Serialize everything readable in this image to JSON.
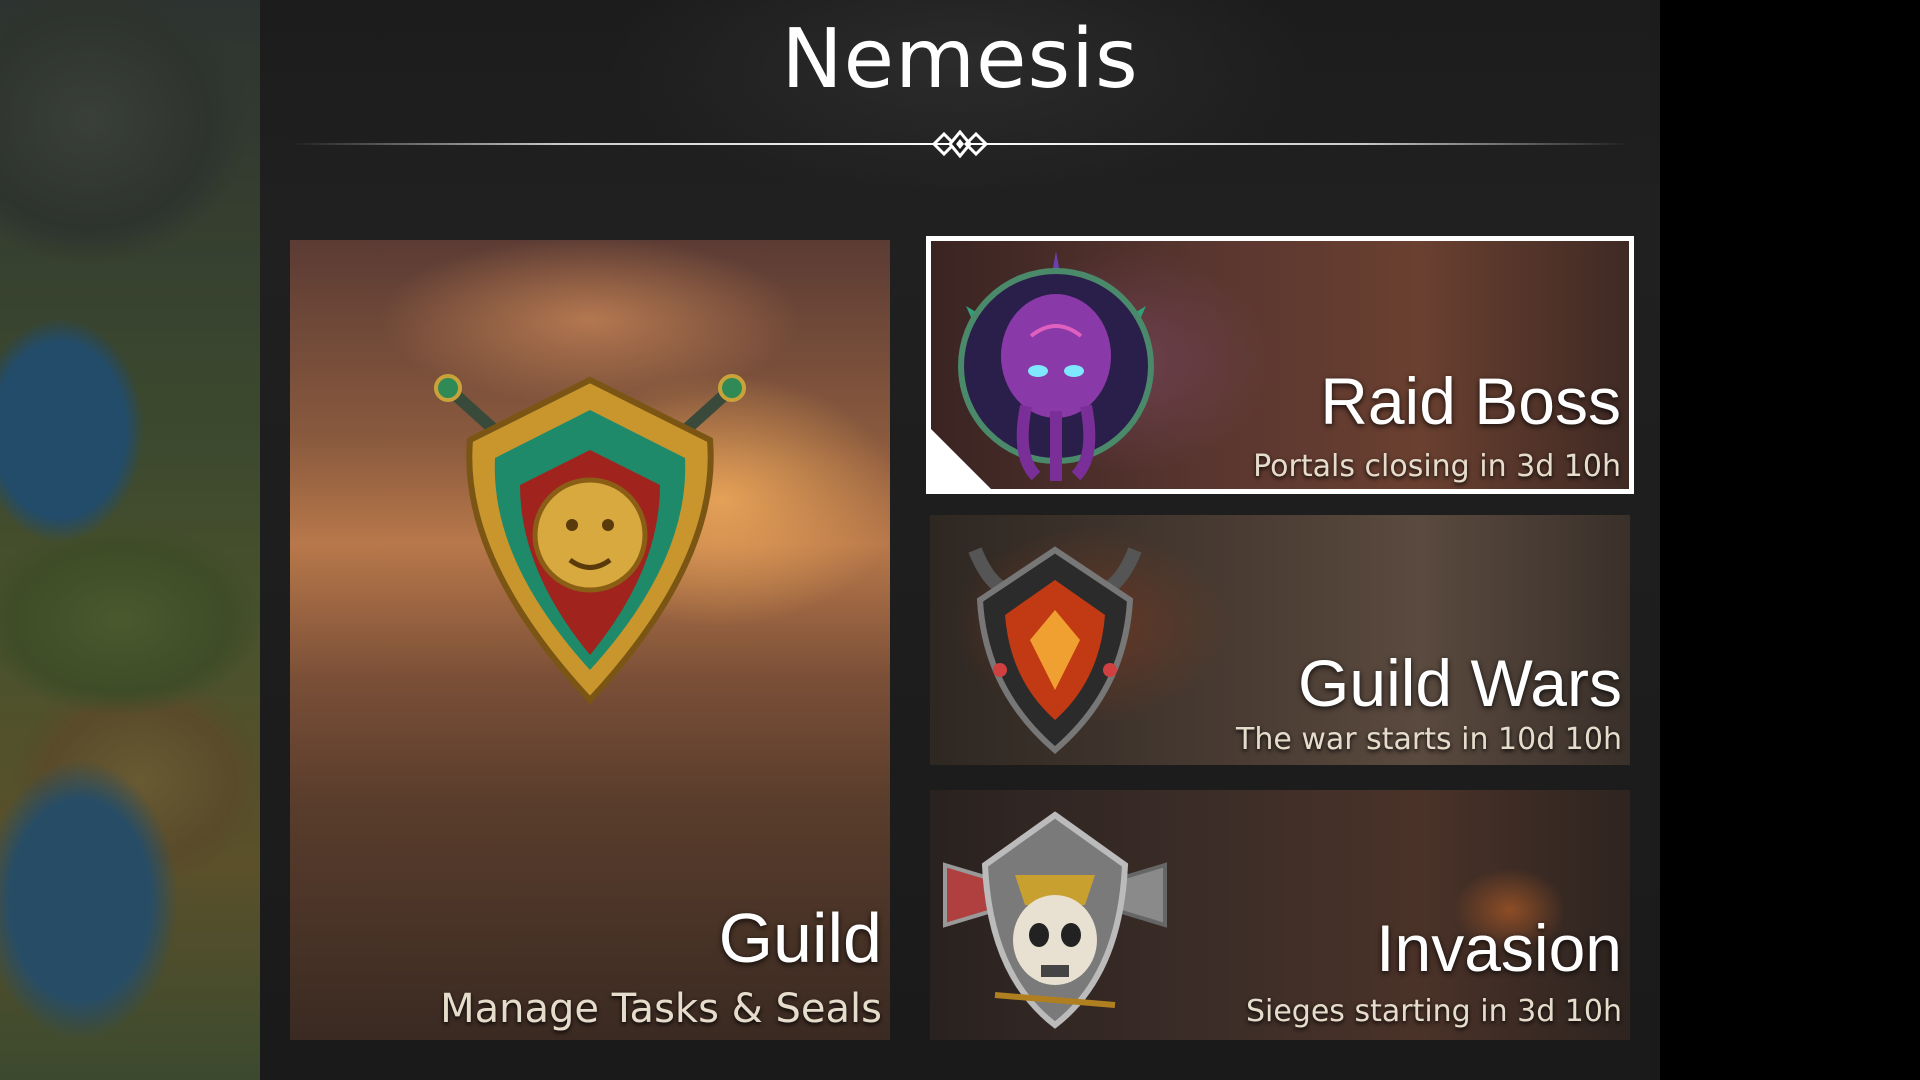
{
  "screen": {
    "title": "Nemesis"
  },
  "cards": {
    "guild": {
      "title": "Guild",
      "subtitle": "Manage Tasks & Seals",
      "emblem": "lion-shield-emblem-icon"
    },
    "raid_boss": {
      "title": "Raid Boss",
      "subtitle": "Portals closing in 3d 10h",
      "emblem": "octopus-demon-emblem-icon",
      "selected": true
    },
    "guild_wars": {
      "title": "Guild Wars",
      "subtitle": "The war starts in 10d 10h",
      "emblem": "horned-shield-emblem-icon"
    },
    "invasion": {
      "title": "Invasion",
      "subtitle": "Sieges starting in 3d 10h",
      "emblem": "skull-helmet-emblem-icon"
    }
  },
  "colors": {
    "title_text": "#ffffff",
    "selected_border": "#ffffff",
    "subtitle_text": "#e6dccb"
  }
}
